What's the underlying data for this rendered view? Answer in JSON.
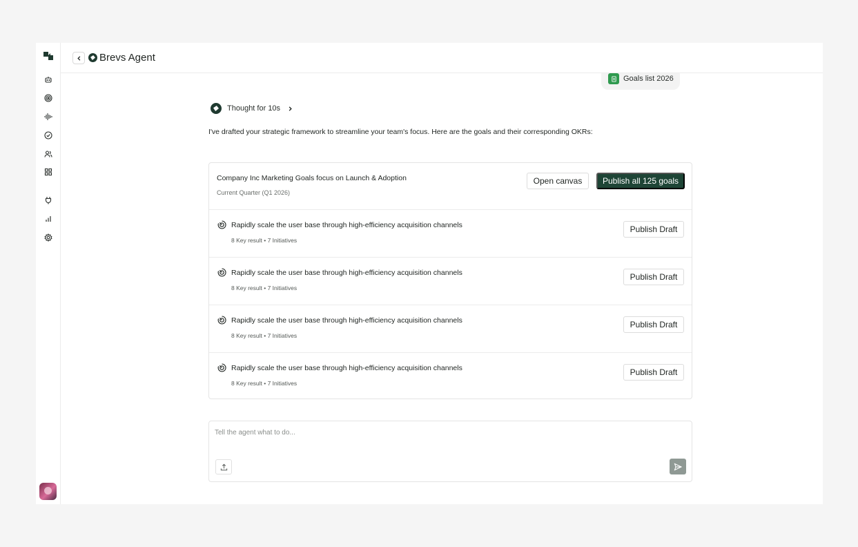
{
  "sidebar": {
    "logo_icon": "brevs-logo-icon",
    "items": [
      {
        "icon": "bot-icon"
      },
      {
        "icon": "target-icon"
      },
      {
        "icon": "audio-waveform-icon"
      },
      {
        "icon": "check-circle-icon"
      },
      {
        "icon": "users-icon"
      },
      {
        "icon": "grid-icon"
      },
      {
        "icon": "plug-icon"
      },
      {
        "icon": "bar-chart-icon"
      },
      {
        "icon": "settings-icon"
      }
    ]
  },
  "header": {
    "title": "Brevs Agent"
  },
  "chat": {
    "attachment": {
      "label": "Goals list 2026",
      "icon": "spreadsheet-icon"
    },
    "thought_label": "Thought for 10s",
    "intro": "I've drafted your strategic framework to streamline your team's focus. Here are the goals and their corresponding OKRs:"
  },
  "goals_card": {
    "title": "Company Inc Marketing Goals focus on Launch & Adoption",
    "subtitle": "Current Quarter (Q1 2026)",
    "open_canvas_label": "Open canvas",
    "publish_all_label": "Publish all 125 goals",
    "goals": [
      {
        "title": "Rapidly scale the user base through high-efficiency acquisition channels",
        "meta": "8 Key result • 7 Initiatives",
        "action": "Publish Draft"
      },
      {
        "title": "Rapidly scale the user base through high-efficiency acquisition channels",
        "meta": "8 Key result • 7 Initiatives",
        "action": "Publish Draft"
      },
      {
        "title": "Rapidly scale the user base through high-efficiency acquisition channels",
        "meta": "8 Key result • 7 Initiatives",
        "action": "Publish Draft"
      },
      {
        "title": "Rapidly scale the user base through high-efficiency acquisition channels",
        "meta": "8 Key result • 7 Initiatives",
        "action": "Publish Draft"
      }
    ]
  },
  "composer": {
    "placeholder": "Tell the agent what to do..."
  },
  "colors": {
    "brand": "#1e4536",
    "send_disabled": "#8f9994",
    "file_green": "#2f9a4f"
  }
}
